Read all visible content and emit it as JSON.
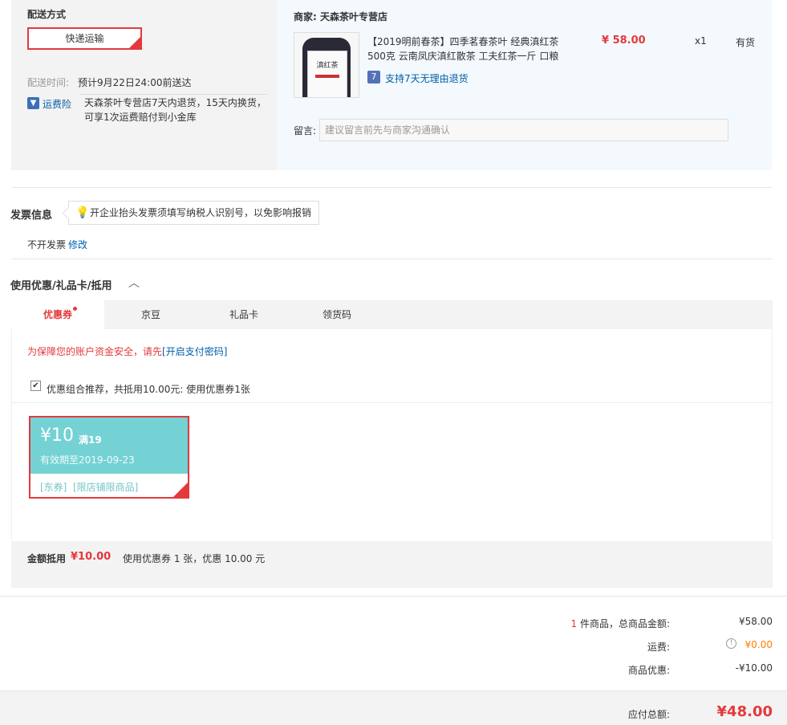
{
  "shipping": {
    "title": "配送方式",
    "method_label": "快递运输",
    "delivery_time_label": "配送时间:",
    "delivery_time_value": "预计9月22日24:00前送达",
    "insurance_label": "运费险",
    "insurance_desc_1": "天森茶叶专营店7天内退货，15天内换货，",
    "insurance_desc_2": "可享1次运费赔付到小金库"
  },
  "merchant": {
    "label": "商家:",
    "name": "天森茶叶专营店",
    "product_title_1": "【2019明前春茶】四季茗春茶叶 经典滇红茶",
    "product_title_2": "500克 云南凤庆滇红散茶 工夫红茶一斤 口粮",
    "price": "¥ 58.00",
    "quantity": "x1",
    "stock": "有货",
    "return_badge": "7",
    "return_policy": "支持7天无理由退货",
    "note_label": "留言:",
    "note_placeholder": "建议留言前先与商家沟通确认",
    "thumb_text": "滇红茶"
  },
  "invoice": {
    "title": "发票信息",
    "tip": "开企业抬头发票须填写纳税人识别号，以免影响报销",
    "status": "不开发票",
    "edit": "修改"
  },
  "discounts": {
    "title": "使用优惠/礼品卡/抵用",
    "tabs": [
      "优惠券",
      "京豆",
      "礼品卡",
      "领货码"
    ],
    "security_notice": "为保障您的账户资金安全，请先",
    "security_link": "[开启支付密码]",
    "combo_text": "优惠组合推荐，共抵用10.00元: 使用优惠券1张",
    "coupon": {
      "amount": "¥10",
      "condition": "满19",
      "expiry": "有效期至2019-09-23",
      "tag1": "[东券]",
      "tag2": "[限店铺限商品]"
    },
    "summary_label": "金额抵用",
    "summary_amount": "¥10.00",
    "summary_detail": "使用优惠券 1 张，优惠 10.00 元"
  },
  "totals": {
    "count": "1",
    "count_suffix": "件商品，总商品金额:",
    "goods_amount": "¥58.00",
    "shipping_label": "运费:",
    "shipping_amount": "¥0.00",
    "discount_label": "商品优惠:",
    "discount_amount": "-¥10.00",
    "payable_label": "应付总额:",
    "payable_amount": "¥48.00"
  }
}
